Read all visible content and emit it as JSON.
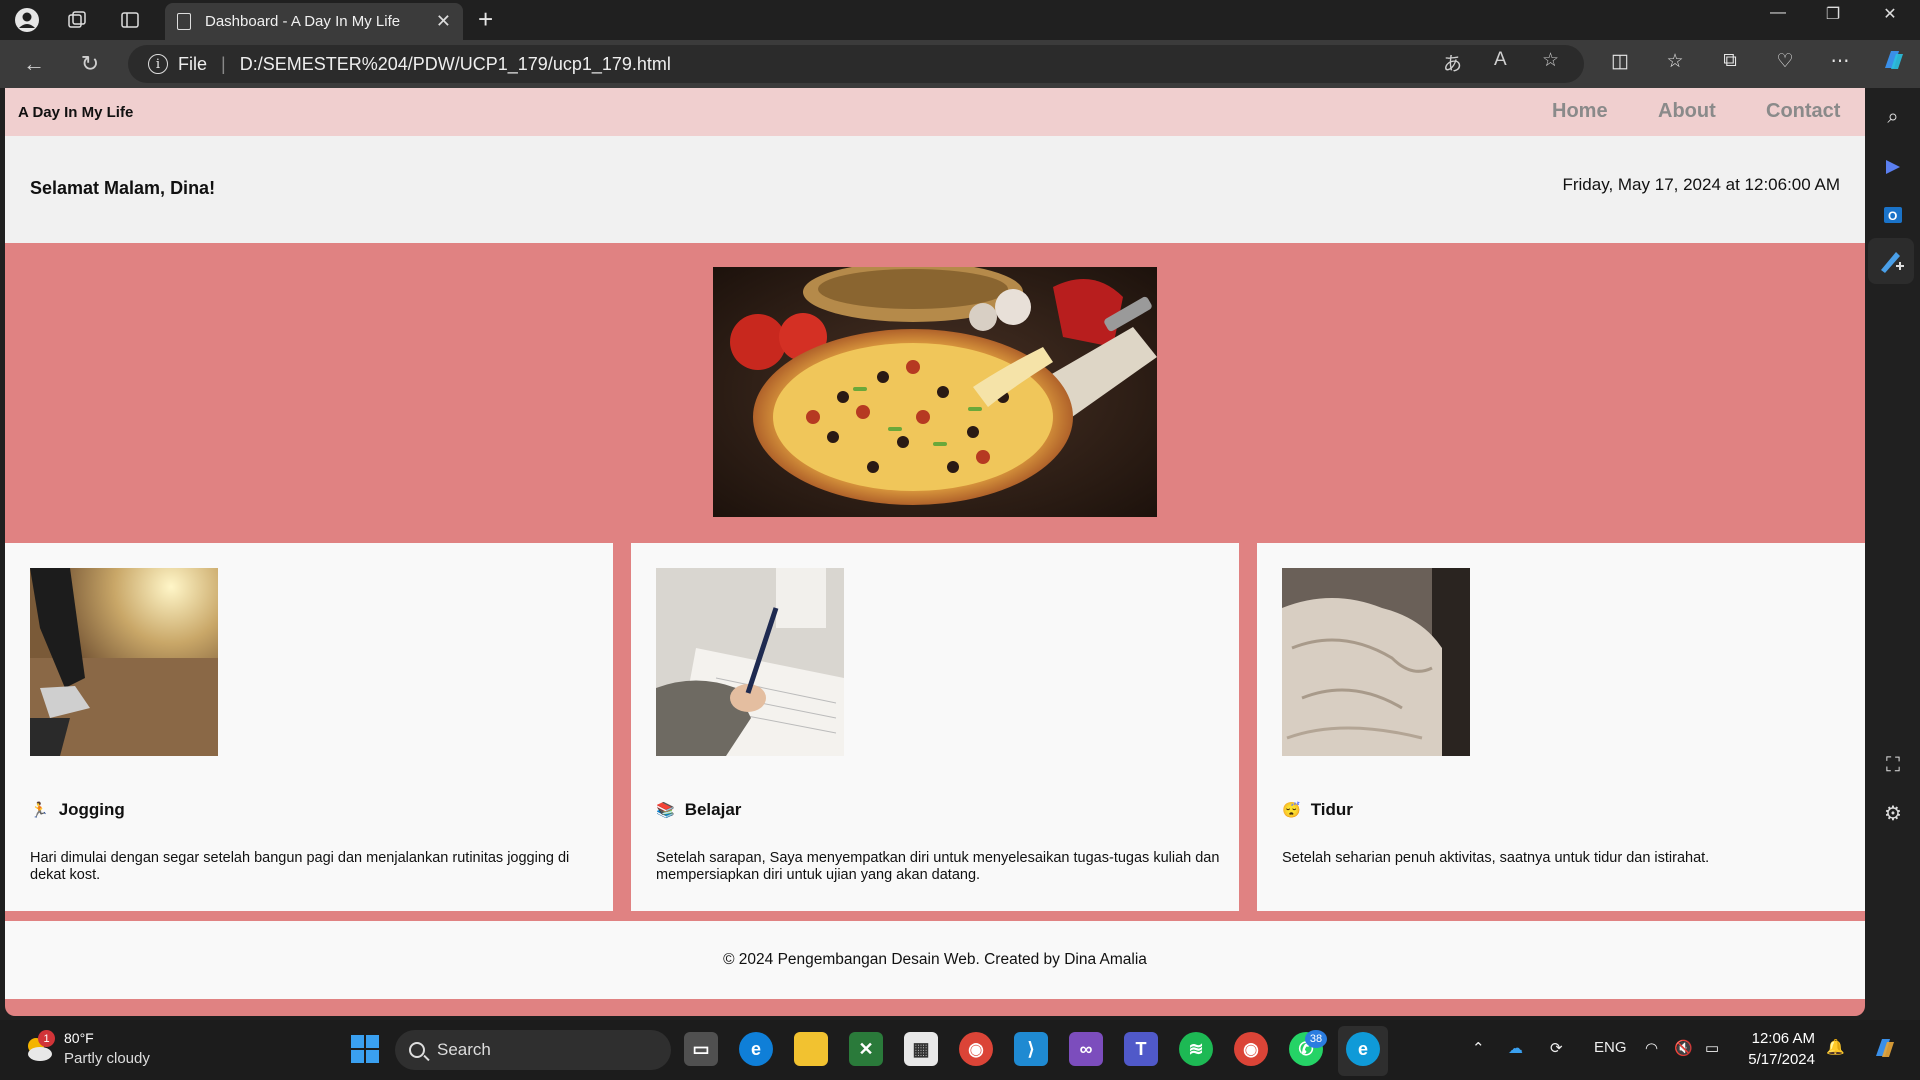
{
  "browser": {
    "tab_title": "Dashboard - A Day In My Life",
    "file_label": "File",
    "url": "D:/SEMESTER%204/PDW/UCP1_179/ucp1_179.html"
  },
  "page": {
    "brand": "A Day In My Life",
    "nav": [
      "Home",
      "About",
      "Contact"
    ],
    "greeting": "Selamat Malam, Dina!",
    "datetime": "Friday, May 17, 2024 at 12:06:00 AM",
    "activities": [
      {
        "emoji": "🏃",
        "title": "Jogging",
        "description": "Hari dimulai dengan segar setelah bangun pagi dan menjalankan rutinitas jogging di dekat kost."
      },
      {
        "emoji": "📚",
        "title": "Belajar",
        "description": "Setelah sarapan, Saya menyempatkan diri untuk menyelesaikan tugas-tugas kuliah dan mempersiapkan diri untuk ujian yang akan datang."
      },
      {
        "emoji": "😴",
        "title": "Tidur",
        "description": "Setelah seharian penuh aktivitas, saatnya untuk tidur dan istirahat."
      }
    ],
    "footer": "© 2024 Pengembangan Desain Web. Created by Dina Amalia"
  },
  "taskbar": {
    "weather_temp": "80°F",
    "weather_condition": "Partly cloudy",
    "weather_badge": "1",
    "search_label": "Search",
    "whatsapp_badge": "38",
    "language": "ENG",
    "time": "12:06 AM",
    "date": "5/17/2024"
  },
  "colors": {
    "navbar_bg": "#f0cfcf",
    "page_accent": "#e08282",
    "card_bg": "#f9f9f9"
  }
}
